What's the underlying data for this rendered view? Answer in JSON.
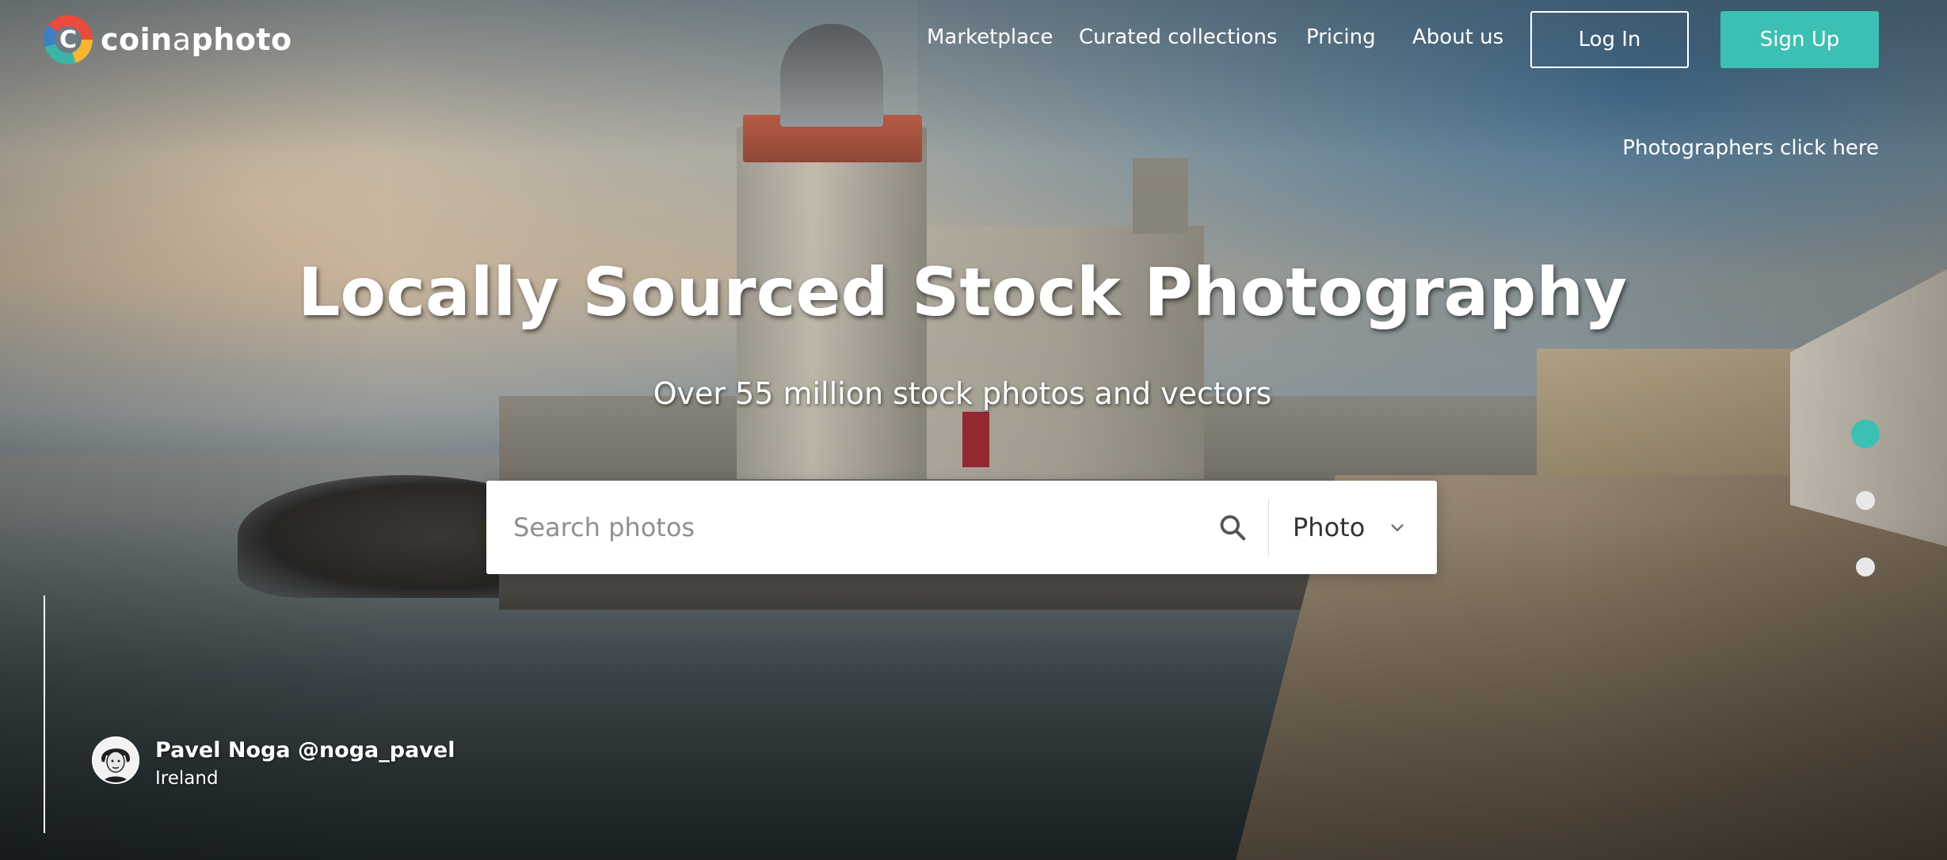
{
  "brand": {
    "logo_bold_1": "coin",
    "logo_thin": "a",
    "logo_bold_2": "photo",
    "logo_icon": "coinaphoto-logo-icon"
  },
  "nav": {
    "items": [
      {
        "label": "Marketplace"
      },
      {
        "label": "Curated collections"
      },
      {
        "label": "Pricing"
      },
      {
        "label": "About us"
      }
    ],
    "login_label": "Log In",
    "signup_label": "Sign Up",
    "photographers_link": "Photographers click here"
  },
  "hero": {
    "headline": "Locally Sourced Stock Photography",
    "subheadline": "Over 55 million stock photos and vectors"
  },
  "search": {
    "placeholder": "Search photos",
    "search_icon": "search-icon",
    "type_selected": "Photo",
    "type_icon": "chevron-down-icon"
  },
  "slider": {
    "slide_count": 3,
    "active_index": 0
  },
  "credit": {
    "name": "Pavel Noga @noga_pavel",
    "location": "Ireland"
  },
  "colors": {
    "accent": "#3cc0b3",
    "text_on_image": "#ffffff",
    "search_bg": "#ffffff"
  }
}
